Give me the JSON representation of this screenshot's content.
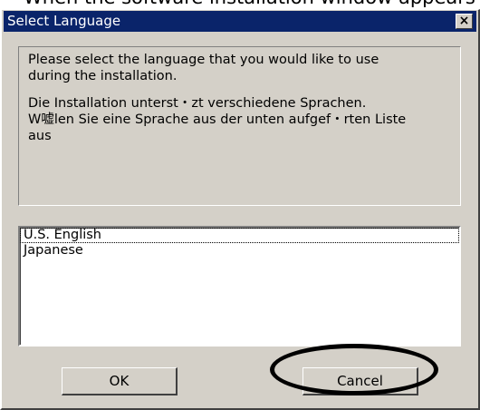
{
  "page_caption": "When the software installation window appears",
  "window": {
    "title": "Select Language",
    "close_label": "×"
  },
  "message": {
    "english": "Please select the language that you would like to use\nduring the installation.",
    "german": "Die Installation unterst・zt verschiedene Sprachen.\nW嘘len Sie eine Sprache aus der unten aufgef・rten Liste\naus"
  },
  "language_list": {
    "items": [
      "U.S. English",
      "Japanese"
    ],
    "selected": "U.S. English"
  },
  "buttons": {
    "ok": "OK",
    "cancel": "Cancel"
  },
  "colors": {
    "title_bar": "#0a246a",
    "dialog_face": "#d4d0c8",
    "annotation_ring": "#000000"
  }
}
